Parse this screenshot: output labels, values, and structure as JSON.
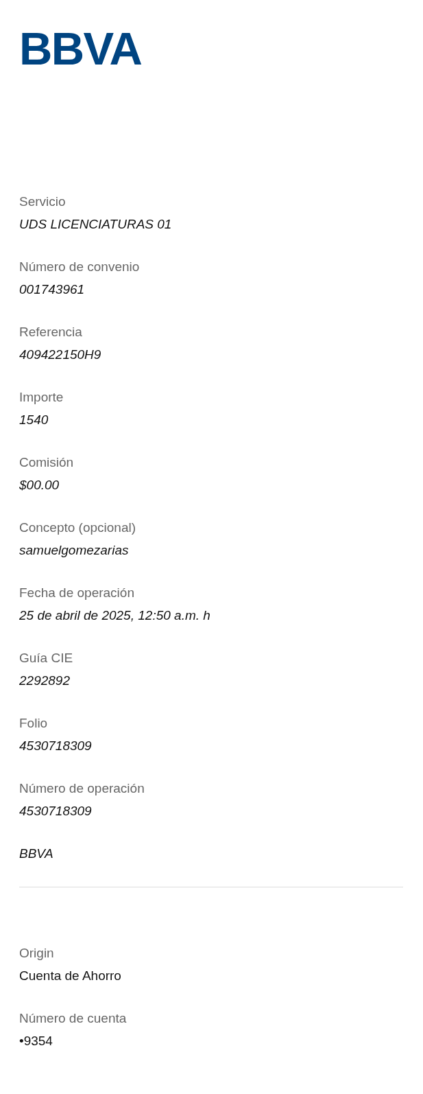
{
  "logo": {
    "text": "BBVA"
  },
  "operation": {
    "fields": [
      {
        "label": "Servicio",
        "value": "UDS LICENCIATURAS 01"
      },
      {
        "label": "Número de convenio",
        "value": "001743961"
      },
      {
        "label": "Referencia",
        "value": "409422150H9"
      },
      {
        "label": "Importe",
        "value": "1540"
      },
      {
        "label": "Comisión",
        "value": "$00.00"
      },
      {
        "label": "Concepto (opcional)",
        "value": "samuelgomezarias"
      },
      {
        "label": "Fecha de operación",
        "value": "25 de abril de 2025, 12:50 a.m. h"
      },
      {
        "label": "Guía CIE",
        "value": "2292892"
      },
      {
        "label": "Folio",
        "value": "4530718309"
      },
      {
        "label": "Número de operación",
        "value": "4530718309"
      }
    ],
    "bank": "BBVA"
  },
  "origin": {
    "fields": [
      {
        "label": "Origin",
        "value": "Cuenta de Ahorro"
      },
      {
        "label": "Número de cuenta",
        "value": "•9354"
      }
    ]
  }
}
